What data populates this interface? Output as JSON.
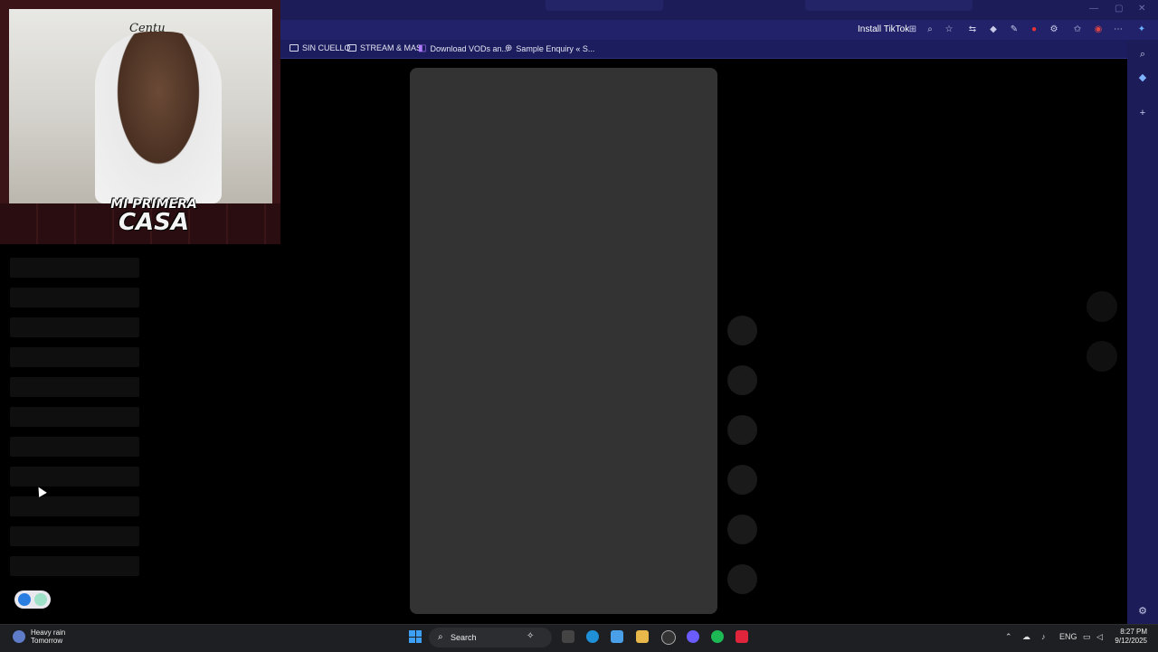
{
  "browser": {
    "install_label": "Install TikTok",
    "bookmarks": [
      {
        "label": "SIN CUELLO"
      },
      {
        "label": "STREAM & MAS"
      },
      {
        "label": "Download VODs an..."
      },
      {
        "label": "Sample Enquiry « S..."
      }
    ]
  },
  "webcam": {
    "overlay_line1": "MI PRIMERA",
    "overlay_line2": "CASA",
    "cap_text": "Centu"
  },
  "taskbar": {
    "weather_line1": "Heavy rain",
    "weather_line2": "Tomorrow",
    "search_label": "Search",
    "language": "ENG",
    "time": "8:27 PM",
    "date": "9/12/2025"
  },
  "colors": {
    "titlebar": "#1b1c58",
    "bookmarks_bar": "#1c1d5e",
    "skeleton": "#333333",
    "taskbar": "#1e1f22"
  }
}
